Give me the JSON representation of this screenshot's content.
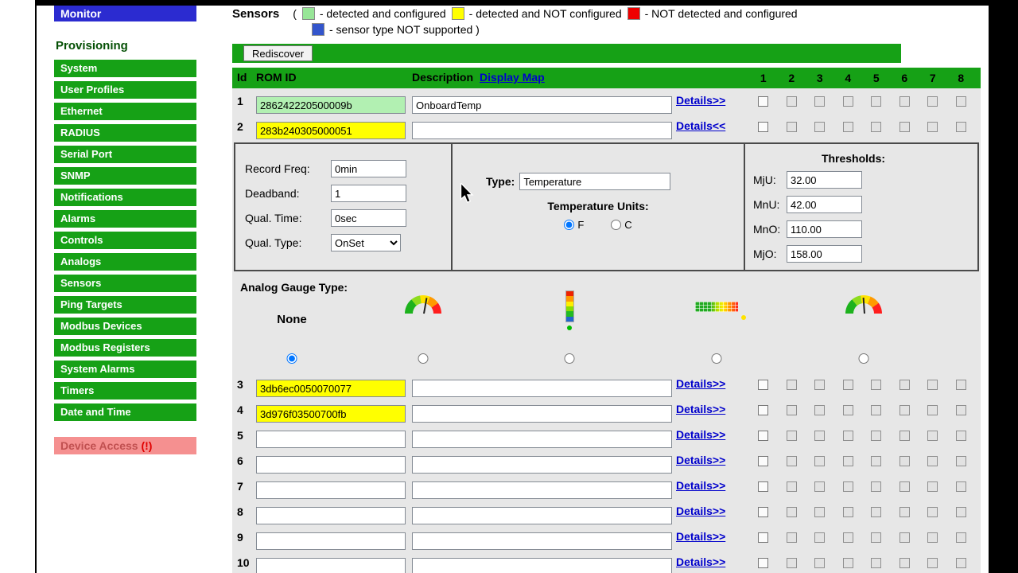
{
  "sidebar": {
    "monitor": "Monitor",
    "provisioning_heading": "Provisioning",
    "items": [
      "System",
      "User Profiles",
      "Ethernet",
      "RADIUS",
      "Serial Port",
      "SNMP",
      "Notifications",
      "Alarms",
      "Controls",
      "Analogs",
      "Sensors",
      "Ping Targets",
      "Modbus Devices",
      "Modbus Registers",
      "System Alarms",
      "Timers",
      "Date and Time"
    ],
    "device_access_label": "Device Access",
    "device_access_alert": "(!)"
  },
  "header": {
    "title": "Sensors",
    "open_paren": "(",
    "legend": [
      {
        "name": "detected-and-configured",
        "color": "#98e698",
        "label": "- detected and configured"
      },
      {
        "name": "detected-and-not-configured",
        "color": "#ffff00",
        "label": "- detected and NOT configured"
      },
      {
        "name": "not-detected-and-configured",
        "color": "#ee0000",
        "label": "- NOT detected and configured"
      },
      {
        "name": "sensor-type-not-supported",
        "color": "#3355cc",
        "label": "- sensor type NOT supported )"
      }
    ]
  },
  "toolbar": {
    "rediscover_label": "Rediscover"
  },
  "table": {
    "id_header": "Id",
    "rom_header": "ROM ID",
    "description_header": "Description",
    "display_map_link": "Display Map",
    "sensor_columns": [
      "1",
      "2",
      "3",
      "4",
      "5",
      "6",
      "7",
      "8"
    ],
    "rows": [
      {
        "id": "1",
        "rom": "286242220500009b",
        "rom_state": "green",
        "description": "OnboardTemp",
        "details": "Details>>"
      },
      {
        "id": "2",
        "rom": "283b240305000051",
        "rom_state": "yellow",
        "description": "",
        "details": "Details<<"
      },
      {
        "id": "3",
        "rom": "3db6ec0050070077",
        "rom_state": "yellow",
        "description": "",
        "details": "Details>>"
      },
      {
        "id": "4",
        "rom": "3d976f03500700fb",
        "rom_state": "yellow",
        "description": "",
        "details": "Details>>"
      },
      {
        "id": "5",
        "rom": "",
        "rom_state": "empty",
        "description": "",
        "details": "Details>>"
      },
      {
        "id": "6",
        "rom": "",
        "rom_state": "empty",
        "description": "",
        "details": "Details>>"
      },
      {
        "id": "7",
        "rom": "",
        "rom_state": "empty",
        "description": "",
        "details": "Details>>"
      },
      {
        "id": "8",
        "rom": "",
        "rom_state": "empty",
        "description": "",
        "details": "Details>>"
      },
      {
        "id": "9",
        "rom": "",
        "rom_state": "empty",
        "description": "",
        "details": "Details>>"
      },
      {
        "id": "10",
        "rom": "",
        "rom_state": "empty",
        "description": "",
        "details": "Details>>"
      }
    ]
  },
  "details_panel": {
    "record_freq_label": "Record Freq:",
    "record_freq_value": "0min",
    "deadband_label": "Deadband:",
    "deadband_value": "1",
    "qual_time_label": "Qual. Time:",
    "qual_time_value": "0sec",
    "qual_type_label": "Qual. Type:",
    "qual_type_value": "OnSet",
    "type_label": "Type:",
    "type_value": "Temperature",
    "units_label": "Temperature Units:",
    "unit_f": "F",
    "unit_c": "C",
    "selected_unit": "F",
    "thresholds_title": "Thresholds:",
    "thresholds": [
      {
        "label": "MjU:",
        "value": "32.00"
      },
      {
        "label": "MnU:",
        "value": "42.00"
      },
      {
        "label": "MnO:",
        "value": "110.00"
      },
      {
        "label": "MjO:",
        "value": "158.00"
      }
    ]
  },
  "gauge_section": {
    "title": "Analog Gauge Type:",
    "none_label": "None",
    "options": [
      "none",
      "radial-gauge",
      "vertical-bar",
      "horizontal-bar",
      "radial-gauge-2"
    ],
    "selected": "none"
  },
  "colors": {
    "menu_green": "#16a116",
    "rom_configured_green": "#b2f0b2",
    "rom_not_configured_yellow": "#ffff00",
    "link_blue": "#0000cc",
    "monitor_blue": "#2b2bd0",
    "device_access_pink": "#f59090"
  }
}
